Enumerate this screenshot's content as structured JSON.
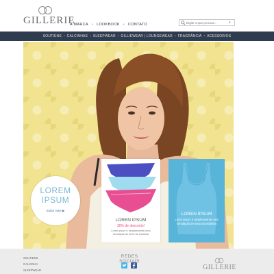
{
  "brand": {
    "name": "GILLERIE"
  },
  "top_nav": [
    "A MARCA",
    "LOOKBOOK",
    "CONTATO"
  ],
  "search": {
    "placeholder": "Digite o que procura..."
  },
  "main_nav": [
    "SOUTIENS",
    "CALCINHAS",
    "SLEEPWEAR",
    "GILLIEWEAR | LOUNGEWEAR",
    "FRAGRÂNCIA",
    "ACESSÓRIOS"
  ],
  "hero": {
    "circle": {
      "line1": "LOREM",
      "line2": "IPSUM",
      "more": "Saiba mais"
    },
    "panties_card": {
      "title": "LOREN IPSUM",
      "promo": "30% de desconto!",
      "description": "Loren Ipsum é simplesmente uma simulação de texto da indústria"
    },
    "tank_card": {
      "title": "LOREN IPSUM",
      "description": "Loren Ipsum é simplesmente uma simulação de texto da indústria"
    }
  },
  "footer": {
    "links": [
      "SOUTIENS",
      "CALCINHA",
      "SLEEPWEAR"
    ],
    "social_title": "REDES SOCIAIS",
    "social_icons": [
      "twitter-icon",
      "facebook-icon"
    ],
    "brand": "GILLERIE"
  },
  "colors": {
    "navbar_bg": "#2f3b4e",
    "hero_bg": "#f1e38f",
    "accent_blue": "#59b4d9",
    "promo_pink": "#e84a7e",
    "footer_bg": "#ececec"
  }
}
